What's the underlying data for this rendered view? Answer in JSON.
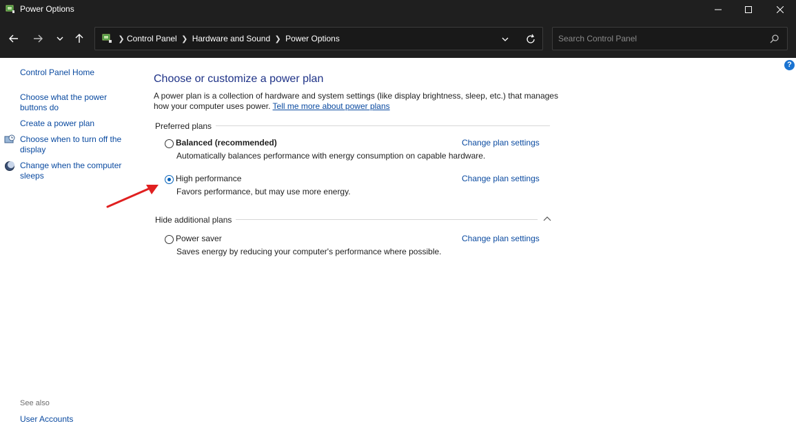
{
  "window": {
    "title": "Power Options"
  },
  "address_bar": {
    "breadcrumbs": [
      "Control Panel",
      "Hardware and Sound",
      "Power Options"
    ],
    "search_placeholder": "Search Control Panel"
  },
  "sidebar": {
    "home": "Control Panel Home",
    "items": [
      {
        "label": "Choose what the power buttons do",
        "icon": null
      },
      {
        "label": "Create a power plan",
        "icon": null
      },
      {
        "label": "Choose when to turn off the display",
        "icon": "display-icon"
      },
      {
        "label": "Change when the computer sleeps",
        "icon": "moon-icon"
      }
    ],
    "see_also_label": "See also",
    "see_also_items": [
      "User Accounts"
    ]
  },
  "main": {
    "title": "Choose or customize a power plan",
    "description": "A power plan is a collection of hardware and system settings (like display brightness, sleep, etc.) that manages how your computer uses power.",
    "description_link": "Tell me more about power plans",
    "preferred_label": "Preferred plans",
    "additional_label": "Hide additional plans",
    "change_link_label": "Change plan settings",
    "plans": [
      {
        "name": "Balanced (recommended)",
        "description": "Automatically balances performance with energy consumption on capable hardware.",
        "selected": false,
        "bold": true
      },
      {
        "name": "High performance",
        "description": "Favors performance, but may use more energy.",
        "selected": true,
        "bold": false
      },
      {
        "name": "Power saver",
        "description": "Saves energy by reducing your computer's performance where possible.",
        "selected": false,
        "bold": false
      }
    ]
  },
  "colors": {
    "titlebar_bg": "#1f1f1f",
    "link": "#0a4aa0",
    "heading": "#1e3287",
    "radio_selected": "#005fb8",
    "annotation_arrow": "#e02020"
  }
}
